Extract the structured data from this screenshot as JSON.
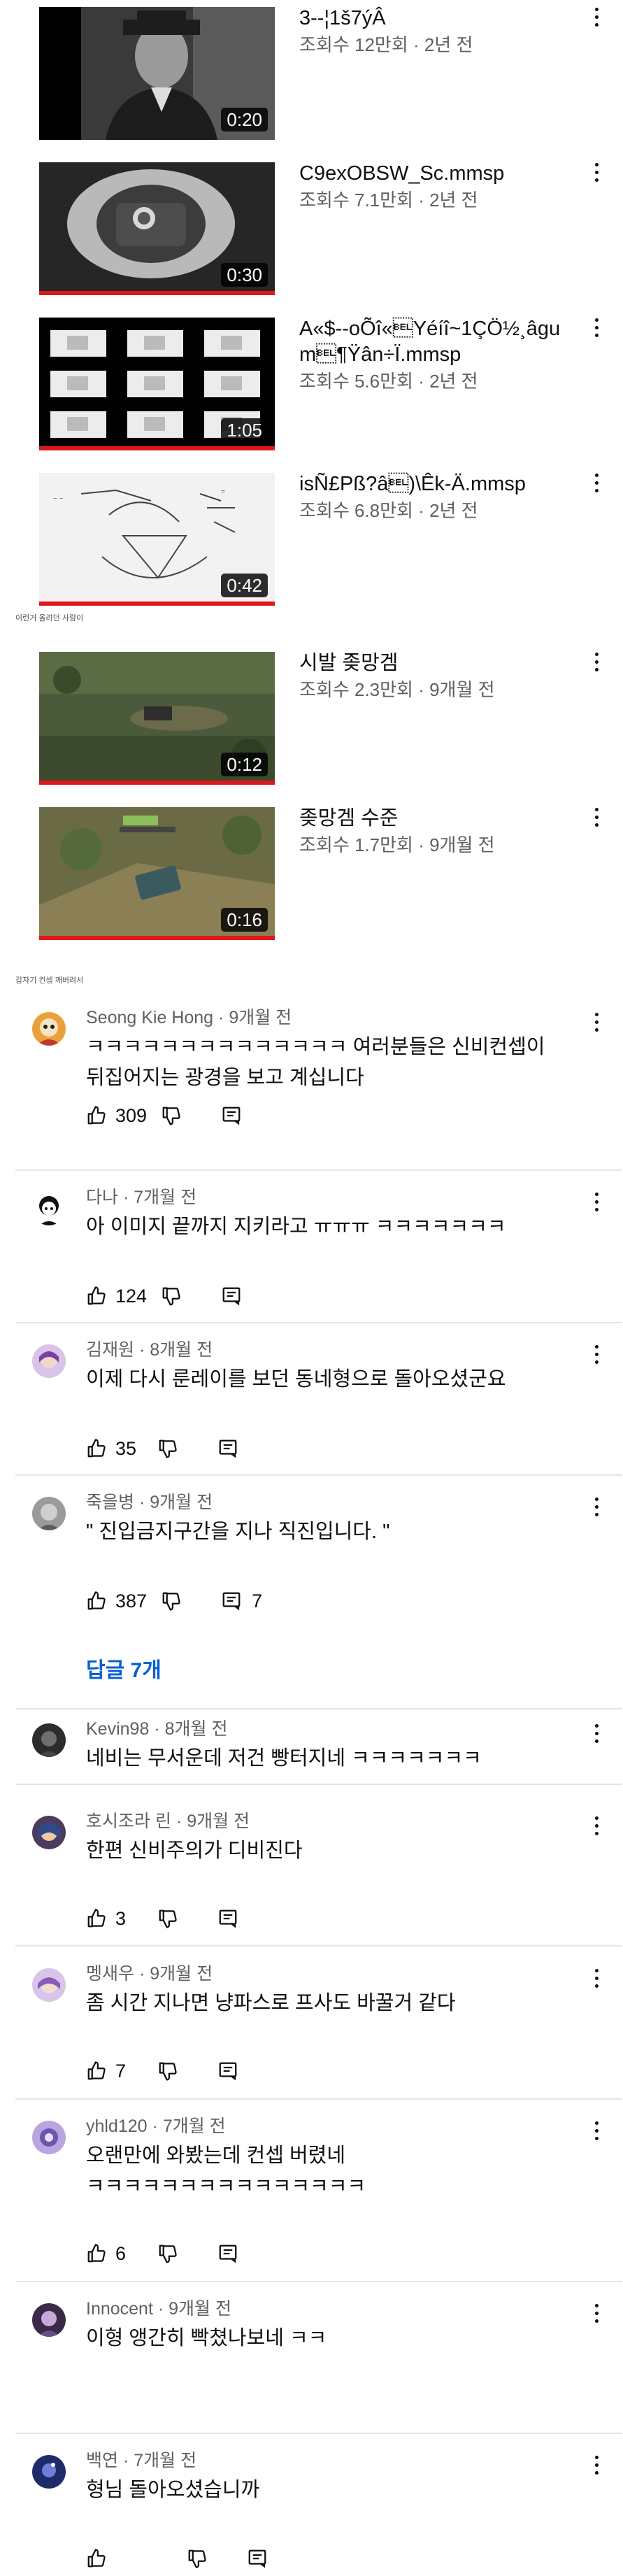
{
  "videos": [
    {
      "title": "3--¦1š7ýÂ",
      "meta": "조회수 12만회 · 2년 전",
      "duration": "0:20",
      "progress": 0
    },
    {
      "title": "C9exOBSW_Sc.mmsp",
      "meta": "조회수 7.1만회 · 2년 전",
      "duration": "0:30",
      "progress": 1
    },
    {
      "title": "A«$--oÕî«\u0007Yéíî~1ÇÖ½¸âgum\u0007¶Ÿân÷Ï.mmsp",
      "meta": "조회수 5.6만회 · 2년 전",
      "duration": "1:05",
      "progress": 1
    },
    {
      "title": "isÑ£Pß?â\u0007)\\Êk-Ä.mmsp",
      "meta": "조회수 6.8만회 · 2년 전",
      "duration": "0:42",
      "progress": 1
    },
    {
      "title": "시발 좆망겜",
      "meta": "조회수 2.3만회 · 9개월 전",
      "duration": "0:12",
      "progress": 1
    },
    {
      "title": "좆망겜 수준",
      "meta": "조회수 1.7만회 · 9개월 전",
      "duration": "0:16",
      "progress": 1
    }
  ],
  "captions": {
    "after_videos": "이런거 올려던 사람이",
    "after_games": "갑자기 컨셉 깨버려서"
  },
  "comments": [
    {
      "author": "Seong Kie Hong",
      "time": "9개월 전",
      "text": "ㅋㅋㅋㅋㅋㅋㅋㅋㅋㅋㅋㅋㅋㅋ 여러분들은 신비컨셉이 뒤집어지는 광경을 보고 계십니다",
      "likes": "309",
      "replies": ""
    },
    {
      "author": "다나",
      "time": "7개월 전",
      "text": "아 이미지 끝까지 지키라고 ㅠㅠㅠ ㅋㅋㅋㅋㅋㅋㅋ",
      "likes": "124",
      "replies": ""
    },
    {
      "author": "김재원",
      "time": "8개월 전",
      "text": "이제 다시 룬레이를 보던 동네형으로 돌아오셨군요",
      "likes": "35",
      "replies": ""
    },
    {
      "author": "죽을병",
      "time": "9개월 전",
      "text": "\" 진입금지구간을 지나 직진입니다. \"",
      "likes": "387",
      "replies": "7",
      "reply_link": "답글 7개"
    },
    {
      "author": "Kevin98",
      "time": "8개월 전",
      "text": "네비는 무서운데 저건 빵터지네 ㅋㅋㅋㅋㅋㅋㅋ",
      "likes": "",
      "replies": ""
    },
    {
      "author": "호시조라 린",
      "time": "9개월 전",
      "text": "한편 신비주의가 디비진다",
      "likes": "3",
      "replies": ""
    },
    {
      "author": "멩새우",
      "time": "9개월 전",
      "text": "좀 시간 지나면 냥파스로 프사도 바꿀거 같다",
      "likes": "7",
      "replies": ""
    },
    {
      "author": "yhld120",
      "time": "7개월 전",
      "text": "오랜만에 와봤는데 컨셉 버렸네 ㅋㅋㅋㅋㅋㅋㅋㅋㅋㅋㅋㅋㅋㅋㅋ",
      "likes": "6",
      "replies": ""
    },
    {
      "author": "Innocent",
      "time": "9개월 전",
      "text": "이형 앵간히 빡쳤나보네 ㅋㅋ",
      "likes": "",
      "replies": ""
    },
    {
      "author": "백연",
      "time": "7개월 전",
      "text": "형님 돌아오셨습니까",
      "likes": "",
      "replies": ""
    }
  ],
  "colors": {
    "accent_progress": "#e0181b",
    "link": "#065fd4",
    "meta": "#606060"
  },
  "icons": [
    "thumb-up-icon",
    "thumb-down-icon",
    "reply-icon",
    "more-vert-icon"
  ]
}
